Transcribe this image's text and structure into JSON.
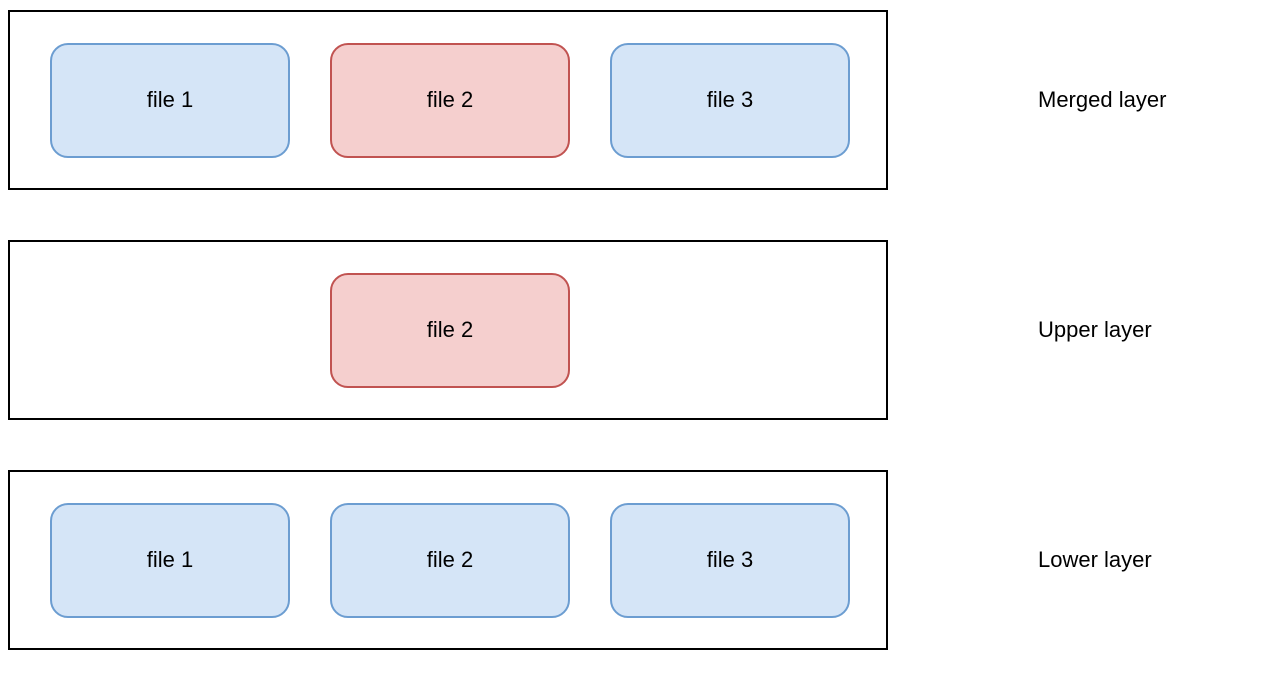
{
  "layers": [
    {
      "label": "Merged layer",
      "files": [
        {
          "name": "file 1",
          "color": "blue"
        },
        {
          "name": "file 2",
          "color": "red"
        },
        {
          "name": "file 3",
          "color": "blue"
        }
      ]
    },
    {
      "label": "Upper layer",
      "files": [
        {
          "name": "",
          "color": "placeholder"
        },
        {
          "name": "file 2",
          "color": "red"
        },
        {
          "name": "",
          "color": "placeholder"
        }
      ]
    },
    {
      "label": "Lower layer",
      "files": [
        {
          "name": "file 1",
          "color": "blue"
        },
        {
          "name": "file 2",
          "color": "blue"
        },
        {
          "name": "file 3",
          "color": "blue"
        }
      ]
    }
  ]
}
